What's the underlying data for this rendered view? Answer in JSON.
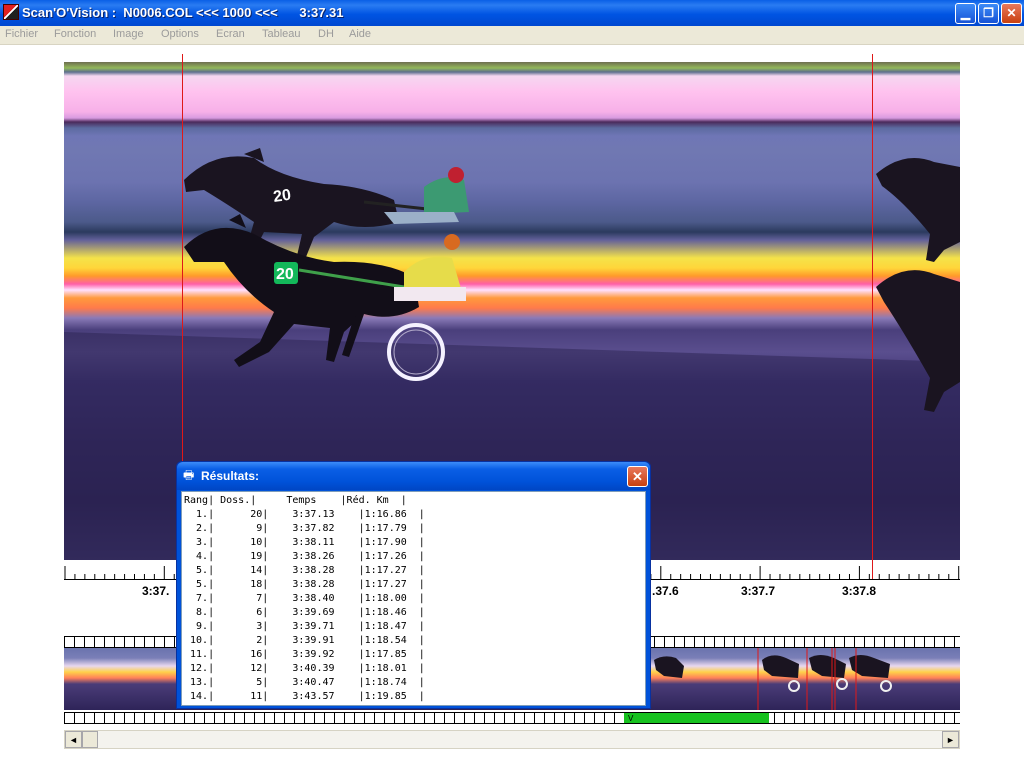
{
  "window": {
    "title": "Scan'O'Vision :  N0006.COL <<< 1000 <<<      3:37.31",
    "min_glyph": "▁",
    "max_glyph": "❐",
    "close_glyph": "✕"
  },
  "menu": [
    "Fichier",
    "Fonction",
    "Image",
    "Options",
    "Ecran",
    "Tableau",
    "DH",
    "Aide"
  ],
  "timeline": {
    "labels": [
      "3:37.",
      ".37.6",
      "3:37.7",
      "3:37.8"
    ]
  },
  "overview": {
    "cursor_glyph": "V"
  },
  "scrollbar": {
    "left_glyph": "◄",
    "right_glyph": "►"
  },
  "results": {
    "title": "Résultats:",
    "icon_glyph": "🖶",
    "close_glyph": "✕",
    "header": [
      "Rang",
      "Doss.",
      "Temps",
      "Réd. Km"
    ],
    "rows": [
      [
        "1.",
        "20",
        "3:37.13",
        "1:16.86"
      ],
      [
        "2.",
        "9",
        "3:37.82",
        "1:17.79"
      ],
      [
        "3.",
        "10",
        "3:38.11",
        "1:17.90"
      ],
      [
        "4.",
        "19",
        "3:38.26",
        "1:17.26"
      ],
      [
        "5.",
        "14",
        "3:38.28",
        "1:17.27"
      ],
      [
        "5.",
        "18",
        "3:38.28",
        "1:17.27"
      ],
      [
        "7.",
        "7",
        "3:38.40",
        "1:18.00"
      ],
      [
        "8.",
        "6",
        "3:39.69",
        "1:18.46"
      ],
      [
        "9.",
        "3",
        "3:39.71",
        "1:18.47"
      ],
      [
        "10.",
        "2",
        "3:39.91",
        "1:18.54"
      ],
      [
        "11.",
        "16",
        "3:39.92",
        "1:17.85"
      ],
      [
        "12.",
        "12",
        "3:40.39",
        "1:18.01"
      ],
      [
        "13.",
        "5",
        "3:40.47",
        "1:18.74"
      ],
      [
        "14.",
        "11",
        "3:43.57",
        "1:19.85"
      ]
    ]
  },
  "photo": {
    "bib_front": "20",
    "bib_back": "20"
  }
}
